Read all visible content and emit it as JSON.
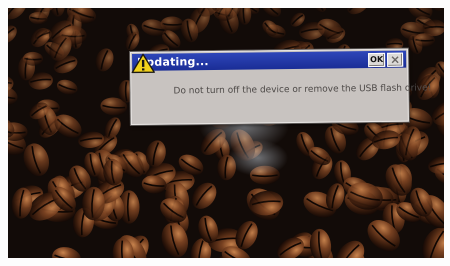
{
  "dialog": {
    "title": "Updating...",
    "ok_label": "OK",
    "message": "Do not turn off the device or remove the USB flash drive!",
    "icon": "warning-icon",
    "title_bar_color": "#1f35a8",
    "body_color": "#c8c3c0"
  },
  "background": {
    "description_icon": "coffee-beans-wallpaper",
    "base_color": "#120b08"
  }
}
